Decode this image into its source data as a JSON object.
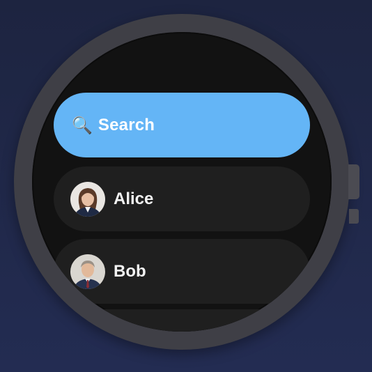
{
  "watch": {
    "accent_color": "#64b5f6",
    "screen_color": "#121212",
    "chip_color": "#1f1f1f"
  },
  "search": {
    "icon": "search-icon",
    "label": "Search"
  },
  "contacts": [
    {
      "name": "Alice",
      "avatar": "alice-avatar"
    },
    {
      "name": "Bob",
      "avatar": "bob-avatar"
    }
  ]
}
